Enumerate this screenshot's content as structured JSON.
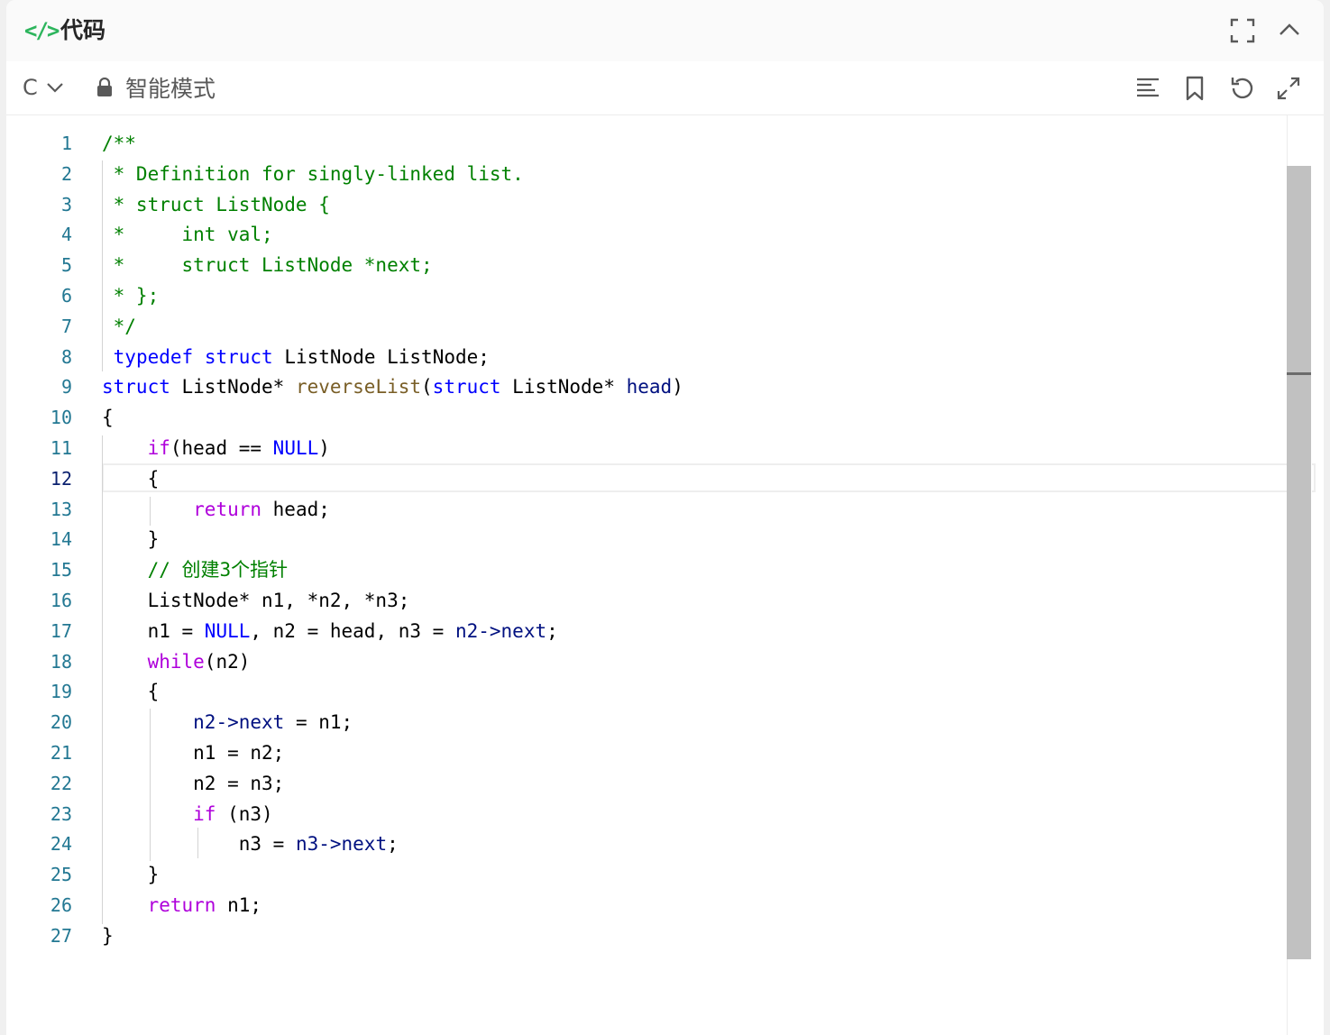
{
  "header": {
    "title": "代码"
  },
  "toolbar": {
    "language": "C",
    "mode_label": "智能模式"
  },
  "editor": {
    "active_line": 12,
    "line_numbers": [
      "1",
      "2",
      "3",
      "4",
      "5",
      "6",
      "7",
      "8",
      "9",
      "10",
      "11",
      "12",
      "13",
      "14",
      "15",
      "16",
      "17",
      "18",
      "19",
      "20",
      "21",
      "22",
      "23",
      "24",
      "25",
      "26",
      "27"
    ],
    "lines": [
      [
        {
          "t": "/**",
          "c": "c"
        }
      ],
      [
        {
          "t": " * Definition for singly-linked list.",
          "c": "c"
        }
      ],
      [
        {
          "t": " * struct ListNode {",
          "c": "c"
        }
      ],
      [
        {
          "t": " *     int val;",
          "c": "c"
        }
      ],
      [
        {
          "t": " *     struct ListNode *next;",
          "c": "c"
        }
      ],
      [
        {
          "t": " * };",
          "c": "c"
        }
      ],
      [
        {
          "t": " */",
          "c": "c"
        }
      ],
      [
        {
          "t": " "
        },
        {
          "t": "typedef",
          "c": "k"
        },
        {
          "t": " "
        },
        {
          "t": "struct",
          "c": "k"
        },
        {
          "t": " ListNode ListNode;"
        }
      ],
      [
        {
          "t": "struct",
          "c": "k"
        },
        {
          "t": " ListNode* "
        },
        {
          "t": "reverseList",
          "c": "f"
        },
        {
          "t": "("
        },
        {
          "t": "struct",
          "c": "k"
        },
        {
          "t": " ListNode* "
        },
        {
          "t": "head",
          "c": "p"
        },
        {
          "t": ")"
        }
      ],
      [
        {
          "t": "{"
        }
      ],
      [
        {
          "t": "    "
        },
        {
          "t": "if",
          "c": "ctl"
        },
        {
          "t": "(head == "
        },
        {
          "t": "NULL",
          "c": "k"
        },
        {
          "t": ")"
        }
      ],
      [
        {
          "t": "    {"
        }
      ],
      [
        {
          "t": "        "
        },
        {
          "t": "return",
          "c": "ctl"
        },
        {
          "t": " head;"
        }
      ],
      [
        {
          "t": "    }"
        }
      ],
      [
        {
          "t": "    // 创建3个指针",
          "c": "c"
        }
      ],
      [
        {
          "t": "    ListNode* n1, *n2, *n3;"
        }
      ],
      [
        {
          "t": "    n1 = "
        },
        {
          "t": "NULL",
          "c": "k"
        },
        {
          "t": ", n2 = head, n3 = "
        },
        {
          "t": "n2->",
          "c": "p"
        },
        {
          "t": "next",
          "c": "p"
        },
        {
          "t": ";"
        }
      ],
      [
        {
          "t": "    "
        },
        {
          "t": "while",
          "c": "ctl"
        },
        {
          "t": "(n2)"
        }
      ],
      [
        {
          "t": "    {"
        }
      ],
      [
        {
          "t": "        "
        },
        {
          "t": "n2->next",
          "c": "p"
        },
        {
          "t": " = n1;"
        }
      ],
      [
        {
          "t": "        n1 = n2;"
        }
      ],
      [
        {
          "t": "        n2 = n3;"
        }
      ],
      [
        {
          "t": "        "
        },
        {
          "t": "if",
          "c": "ctl"
        },
        {
          "t": " (n3)"
        }
      ],
      [
        {
          "t": "            n3 = "
        },
        {
          "t": "n3->next",
          "c": "p"
        },
        {
          "t": ";"
        }
      ],
      [
        {
          "t": "    }"
        }
      ],
      [
        {
          "t": "    "
        },
        {
          "t": "return",
          "c": "ctl"
        },
        {
          "t": " n1;"
        }
      ],
      [
        {
          "t": "}"
        }
      ]
    ]
  },
  "icons": {
    "header": [
      "code-icon",
      "fullscreen-icon",
      "collapse-up-icon"
    ],
    "toolbar": [
      "chevron-down-icon",
      "lock-icon",
      "format-icon",
      "bookmark-icon",
      "undo-icon",
      "expand-icon"
    ]
  },
  "colors": {
    "comment": "#008000",
    "keyword": "#0000ff",
    "function": "#795e26",
    "identifier": "#001080",
    "control": "#af00db",
    "line_number": "#237893",
    "accent": "#2db55d"
  }
}
